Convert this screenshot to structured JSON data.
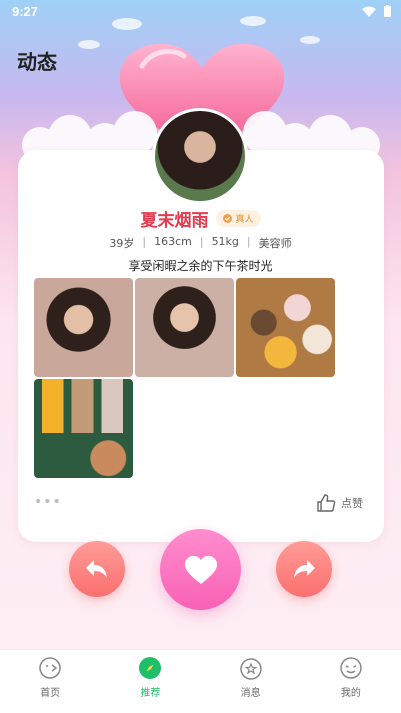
{
  "status": {
    "time": "9:27"
  },
  "header": {
    "title": "动态"
  },
  "profile": {
    "name": "夏末烟雨",
    "badge": "真人",
    "age": "39岁",
    "height": "163cm",
    "weight": "51kg",
    "job": "美容师",
    "bio": "享受闲暇之余的下午茶时光"
  },
  "card": {
    "dots": "•••",
    "like_label": "点赞"
  },
  "tabs": [
    {
      "label": "首页"
    },
    {
      "label": "推荐"
    },
    {
      "label": "消息"
    },
    {
      "label": "我的"
    }
  ],
  "colors": {
    "name": "#e43a4f",
    "accent_green": "#1fbf6a",
    "like_button": "#f862b4",
    "side_buttons": "#fb6f70"
  }
}
